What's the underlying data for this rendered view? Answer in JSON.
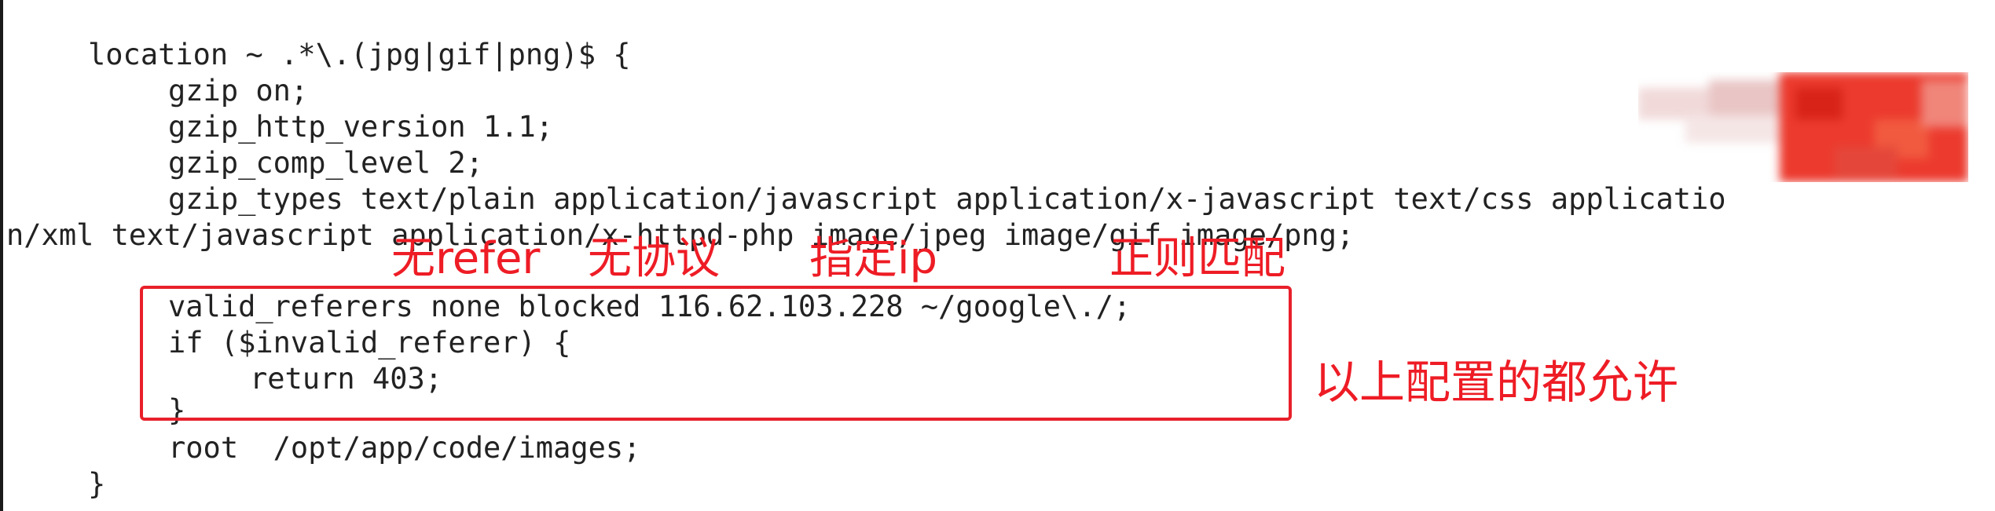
{
  "code": {
    "lines": [
      "location ~ .*\\.(jpg|gif|png)$ {",
      "gzip on;",
      "gzip_http_version 1.1;",
      "gzip_comp_level 2;",
      "gzip_types text/plain application/javascript application/x-javascript text/css applicatio",
      "n/xml text/javascript application/x-httpd-php image/jpeg image/gif image/png;",
      "valid_referers none blocked 116.62.103.228 ~/google\\./;",
      "if ($invalid_referer) {",
      "return 403;",
      "}",
      "root  /opt/app/code/images;",
      "}"
    ]
  },
  "annotations": {
    "no_refer": "无refer",
    "no_protocol": "无协议",
    "specified_ip": "指定ip",
    "regex_match": "正则匹配",
    "allowed_note": "以上配置的都允许"
  },
  "colors": {
    "annotation_red": "#ee1c25",
    "code_text": "#222222",
    "background": "#ffffff"
  },
  "icons": {
    "blurred_watermark": "pixelated-watermark-icon"
  }
}
